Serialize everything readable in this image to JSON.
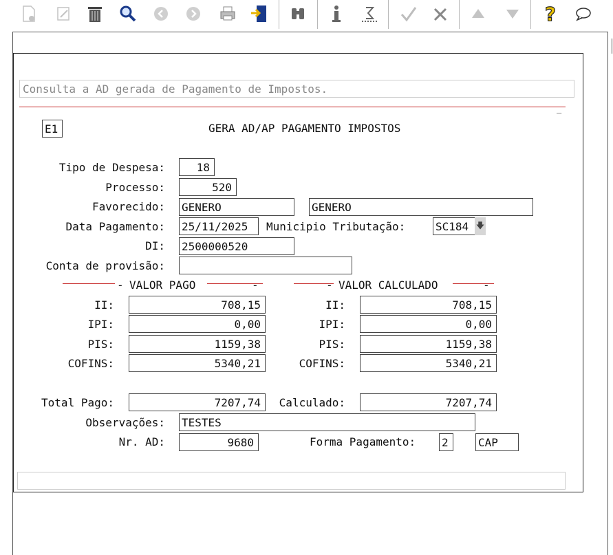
{
  "toolbar": {
    "icons": [
      "new-icon",
      "edit-icon",
      "delete-icon",
      "search-icon",
      "previous-icon",
      "next-icon",
      "print-icon",
      "export-icon",
      "binoculars-icon",
      "info-icon",
      "sum-icon",
      "confirm-icon",
      "cancel-icon",
      "up-icon",
      "down-icon",
      "help-icon",
      "comment-icon"
    ]
  },
  "message": "Consulta a AD gerada de Pagamento de Impostos.",
  "screen_code": "E1",
  "title": "GERA AD/AP PAGAMENTO IMPOSTOS",
  "fields": {
    "tipo_despesa": {
      "label": "Tipo de Despesa:",
      "value": "18"
    },
    "processo": {
      "label": "Processo:",
      "value": "520"
    },
    "favorecido": {
      "label": "Favorecido:",
      "value": "GENERO",
      "value2": "GENERO"
    },
    "data_pagamento": {
      "label": "Data Pagamento:",
      "value": "25/11/2025"
    },
    "municipio": {
      "label": "Municipio Tributação:",
      "value": "SC184"
    },
    "di": {
      "label": "DI:",
      "value": "2500000520"
    },
    "conta_provisao": {
      "label": "Conta de provisão:",
      "value": ""
    }
  },
  "valor_pago": {
    "header": "VALOR PAGO",
    "ii": {
      "label": "II:",
      "value": "708,15"
    },
    "ipi": {
      "label": "IPI:",
      "value": "0,00"
    },
    "pis": {
      "label": "PIS:",
      "value": "1159,38"
    },
    "cofins": {
      "label": "COFINS:",
      "value": "5340,21"
    }
  },
  "valor_calculado": {
    "header": "VALOR CALCULADO",
    "ii": {
      "label": "II:",
      "value": "708,15"
    },
    "ipi": {
      "label": "IPI:",
      "value": "0,00"
    },
    "pis": {
      "label": "PIS:",
      "value": "1159,38"
    },
    "cofins": {
      "label": "COFINS:",
      "value": "5340,21"
    }
  },
  "totals": {
    "total_pago": {
      "label": "Total Pago:",
      "value": "7207,74"
    },
    "calculado": {
      "label": "Calculado:",
      "value": "7207,74"
    }
  },
  "observacoes": {
    "label": "Observações:",
    "value": "TESTES"
  },
  "nr_ad": {
    "label": "Nr. AD:",
    "value": "9680"
  },
  "forma_pagamento": {
    "label": "Forma Pagamento:",
    "code": "2",
    "value": "CAP"
  }
}
